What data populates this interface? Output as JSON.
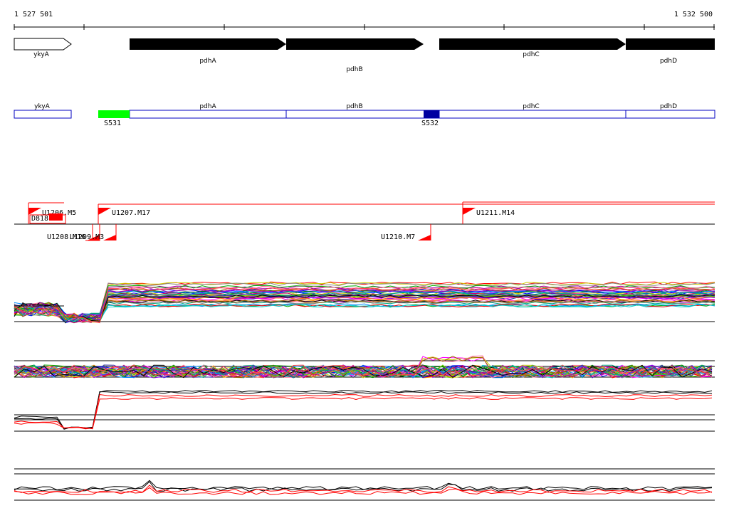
{
  "ruler": {
    "start_label": "1 527 501",
    "end_label": "1 532 500"
  },
  "genes": [
    {
      "name": "ykyA",
      "strand": "+",
      "fill": "white"
    },
    {
      "name": "pdhA",
      "strand": "+",
      "fill": "black"
    },
    {
      "name": "pdhB",
      "strand": "+",
      "fill": "black"
    },
    {
      "name": "pdhC",
      "strand": "+",
      "fill": "black"
    },
    {
      "name": "pdhD",
      "strand": "+",
      "fill": "black"
    }
  ],
  "segments": [
    {
      "label": "ykyA"
    },
    {
      "label": "pdhA"
    },
    {
      "label": "pdhB"
    },
    {
      "label": "pdhC"
    },
    {
      "label": "pdhD"
    }
  ],
  "markers": [
    {
      "label": "S531",
      "color": "#00ff00"
    },
    {
      "label": "S532",
      "color": "#0000a0"
    }
  ],
  "transcription_units": [
    {
      "label": "U1206.M5"
    },
    {
      "label": "D818"
    },
    {
      "label": "U1207.M17"
    },
    {
      "label": "U1211.M14"
    },
    {
      "label": "U1208.M16"
    },
    {
      "label": "U1209.M3"
    },
    {
      "label": "U1210.M7"
    }
  ],
  "colors": {
    "accent_red": "#ff0000",
    "outline_blue": "#0000c0",
    "marker_green": "#00ff00",
    "marker_blue": "#0000a0"
  }
}
